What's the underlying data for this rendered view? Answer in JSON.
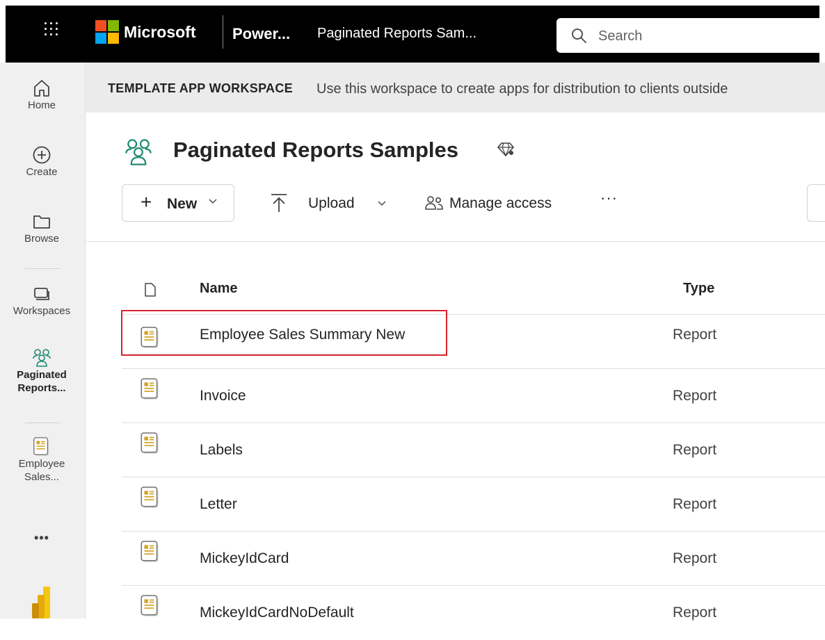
{
  "header": {
    "brand": "Microsoft",
    "product": "Power...",
    "breadcrumb": "Paginated Reports Sam...",
    "search_placeholder": "Search"
  },
  "nav": {
    "items": [
      {
        "label": "Home",
        "icon": "home-icon"
      },
      {
        "label": "Create",
        "icon": "create-icon"
      },
      {
        "label": "Browse",
        "icon": "folder-icon"
      },
      {
        "label": "Workspaces",
        "icon": "workspaces-icon"
      },
      {
        "label": "Paginated Reports...",
        "icon": "workspace-people-icon"
      },
      {
        "label": "Employee Sales...",
        "icon": "report-icon"
      }
    ],
    "more": "•••"
  },
  "banner": {
    "label": "TEMPLATE APP WORKSPACE",
    "text": "Use this workspace to create apps for distribution to clients outside"
  },
  "workspace": {
    "title": "Paginated Reports Samples"
  },
  "toolbar": {
    "new_label": "New",
    "upload_label": "Upload",
    "manage_access_label": "Manage access",
    "more": "···"
  },
  "table": {
    "columns": {
      "name": "Name",
      "type": "Type"
    },
    "rows": [
      {
        "name": "Employee Sales Summary New",
        "type": "Report"
      },
      {
        "name": "Invoice",
        "type": "Report"
      },
      {
        "name": "Labels",
        "type": "Report"
      },
      {
        "name": "Letter",
        "type": "Report"
      },
      {
        "name": "MickeyIdCard",
        "type": "Report"
      },
      {
        "name": "MickeyIdCardNoDefault",
        "type": "Report"
      }
    ]
  },
  "colors": {
    "accent_teal": "#1e8a6e",
    "highlight": "#d9232d",
    "report_icon": "#d4a21f"
  }
}
